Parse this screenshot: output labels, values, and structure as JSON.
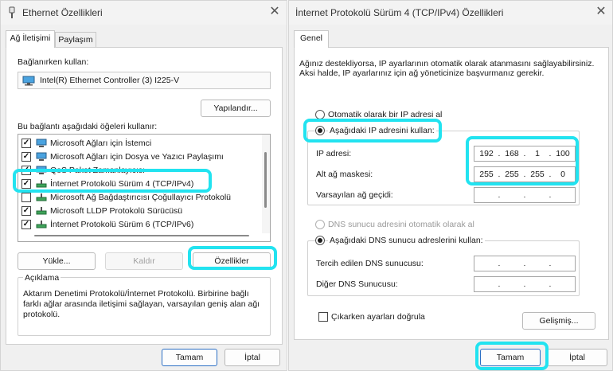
{
  "left_window": {
    "title": "Ethernet Özellikleri",
    "tabs": [
      "Ağ İletişimi",
      "Paylaşım"
    ],
    "connect_using_label": "Bağlanırken kullan:",
    "adapter_name": "Intel(R) Ethernet Controller (3) I225-V",
    "configure_button": "Yapılandır...",
    "items_label": "Bu bağlantı aşağıdaki öğeleri kullanır:",
    "items": [
      {
        "label": "Microsoft Ağları için İstemci",
        "checked": true
      },
      {
        "label": "Microsoft Ağları için Dosya ve Yazıcı Paylaşımı",
        "checked": true
      },
      {
        "label": "QoS Paket Zamanlayıcısı",
        "checked": true
      },
      {
        "label": "İnternet Protokolü Sürüm 4 (TCP/IPv4)",
        "checked": true
      },
      {
        "label": "Microsoft Ağ Bağdaştırıcısı Çoğullayıcı Protokolü",
        "checked": false
      },
      {
        "label": "Microsoft LLDP Protokolü Sürücüsü",
        "checked": true
      },
      {
        "label": "İnternet Protokolü Sürüm 6 (TCP/IPv6)",
        "checked": true
      }
    ],
    "install_button": "Yükle...",
    "uninstall_button": "Kaldır",
    "properties_button": "Özellikler",
    "description_title": "Açıklama",
    "description_text": "Aktarım Denetimi Protokolü/İnternet Protokolü. Birbirine bağlı farklı ağlar arasında iletişimi sağlayan, varsayılan geniş alan ağı protokolü.",
    "ok_button": "Tamam",
    "cancel_button": "İptal"
  },
  "right_window": {
    "title": "İnternet Protokolü Sürüm 4 (TCP/IPv4) Özellikleri",
    "tab": "Genel",
    "intro_text": "Ağınız destekliyorsa, IP ayarlarının otomatik olarak atanmasını sağlayabilirsiniz. Aksi halde, IP ayarlarınız için ağ yöneticinize başvurmanız gerekir.",
    "auto_ip_radio": "Otomatik olarak bir IP adresi al",
    "manual_ip_radio": "Aşağıdaki IP adresini kullan:",
    "ip_address_label": "IP adresi:",
    "ip_address": [
      "192",
      "168",
      "1",
      "100"
    ],
    "subnet_label": "Alt ağ maskesi:",
    "subnet_mask": [
      "255",
      "255",
      "255",
      "0"
    ],
    "gateway_label": "Varsayılan ağ geçidi:",
    "auto_dns_radio": "DNS sunucu adresini otomatik olarak al",
    "manual_dns_radio": "Aşağıdaki DNS sunucu adreslerini kullan:",
    "preferred_dns_label": "Tercih edilen DNS sunucusu:",
    "alternate_dns_label": "Diğer DNS Sunucusu:",
    "validate_checkbox": "Çıkarken ayarları doğrula",
    "advanced_button": "Gelişmiş...",
    "ok_button": "Tamam",
    "cancel_button": "İptal"
  },
  "colors": {
    "highlight": "#22e3f0",
    "accent": "#2c6fc4"
  }
}
